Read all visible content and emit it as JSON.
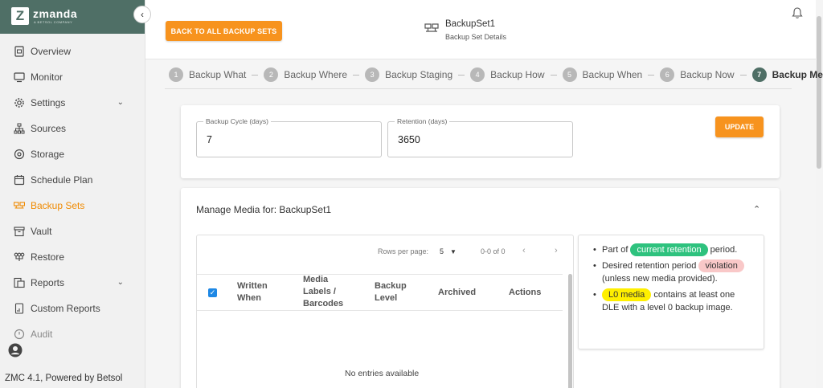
{
  "brand": {
    "logo_letter": "Z",
    "name": "zmanda",
    "tagline": "A BETSOL COMPANY"
  },
  "collapse_icon": "‹",
  "sidebar": {
    "items": [
      {
        "label": "Overview",
        "icon": "overview-icon"
      },
      {
        "label": "Monitor",
        "icon": "monitor-icon"
      },
      {
        "label": "Settings",
        "icon": "gear-icon",
        "has_chevron": true
      },
      {
        "label": "Sources",
        "icon": "sources-icon"
      },
      {
        "label": "Storage",
        "icon": "storage-icon"
      },
      {
        "label": "Schedule Plan",
        "icon": "calendar-icon"
      },
      {
        "label": "Backup Sets",
        "icon": "backup-sets-icon",
        "active": true
      },
      {
        "label": "Vault",
        "icon": "vault-icon"
      },
      {
        "label": "Restore",
        "icon": "restore-icon"
      },
      {
        "label": "Reports",
        "icon": "reports-icon",
        "has_chevron": true
      },
      {
        "label": "Custom Reports",
        "icon": "custom-reports-icon"
      },
      {
        "label": "Audit",
        "icon": "audit-icon"
      }
    ],
    "chevron": "⌄",
    "footer": "ZMC 4.1, Powered by Betsol"
  },
  "header": {
    "back_label": "BACK TO ALL BACKUP SETS",
    "set_name": "BackupSet1",
    "set_subtitle": "Backup Set Details"
  },
  "steps": [
    {
      "num": "1",
      "label": "Backup What"
    },
    {
      "num": "2",
      "label": "Backup Where"
    },
    {
      "num": "3",
      "label": "Backup Staging"
    },
    {
      "num": "4",
      "label": "Backup How"
    },
    {
      "num": "5",
      "label": "Backup When"
    },
    {
      "num": "6",
      "label": "Backup Now"
    },
    {
      "num": "7",
      "label": "Backup Media",
      "active": true
    }
  ],
  "settings_card": {
    "cycle_label": "Backup Cycle (days)",
    "cycle_value": "7",
    "retention_label": "Retention (days)",
    "retention_value": "3650",
    "update_label": "UPDATE"
  },
  "media": {
    "title": "Manage Media for: BackupSet1",
    "collapse_icon": "⌃",
    "rows_per_page_label": "Rows per page:",
    "rows_per_page_value": "5",
    "caret": "▼",
    "range": "0-0 of 0",
    "prev": "‹",
    "next": "›",
    "checkbox": "✓",
    "columns": [
      "Written When",
      "Media Labels / Barcodes",
      "Backup Level",
      "Archived",
      "Actions"
    ],
    "empty": "No entries available"
  },
  "legend": {
    "item1_pre": "Part of",
    "item1_pill": "current retention",
    "item1_post": "period.",
    "item2_pre": "Desired retention period",
    "item2_pill": "violation",
    "item2_post": "(unless new media provided).",
    "item3_pill": "L0 media",
    "item3_post": "contains at least one DLE with a level 0 backup image.",
    "colors": {
      "green": "#2ec27e",
      "pink": "#f9c8c8",
      "yellow": "#ffef00"
    }
  },
  "colors": {
    "accent": "#f7931e",
    "brand": "#4f6f66",
    "active_nav": "#f08a00"
  }
}
